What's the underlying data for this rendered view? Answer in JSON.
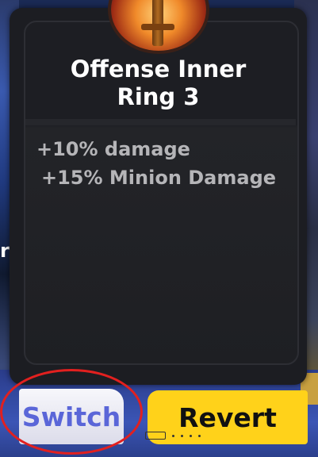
{
  "ring": {
    "title_line1": "Offense Inner",
    "title_line2": "Ring 3",
    "icon": "sword-emblem-icon"
  },
  "stats": [
    "+10% damage",
    "+15% Minion Damage"
  ],
  "buttons": {
    "switch_label": "Switch",
    "revert_label": "Revert"
  },
  "edge": {
    "left_letter": "r"
  },
  "colors": {
    "panel_bg": "#1c1d22",
    "switch_text": "#5a66d8",
    "revert_bg": "#ffd21a",
    "annotation": "#e2201f"
  }
}
